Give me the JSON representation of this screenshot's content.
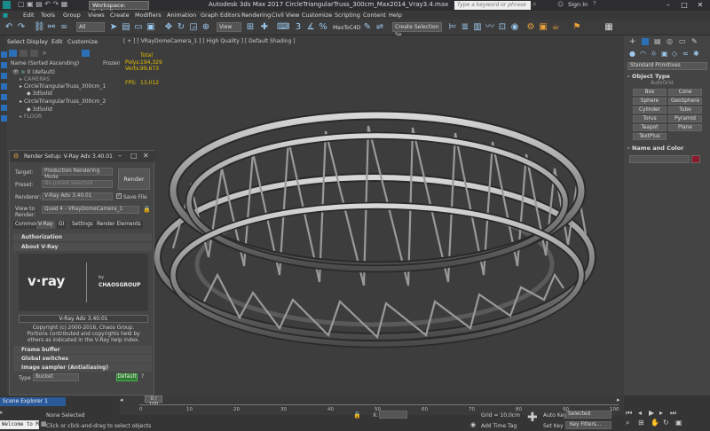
{
  "titlebar": {
    "workspace": "Workspace: Default",
    "title": "Autodesk 3ds Max 2017    CircleTriangularTruss_300cm_Max2014_Vray3.4.max",
    "search_placeholder": "Type a keyword or phrase",
    "sign_in": "Sign In"
  },
  "menu": [
    "Edit",
    "Tools",
    "Group",
    "Views",
    "Create",
    "Modifiers",
    "Animation",
    "Graph Editors",
    "Rendering",
    "Civil View",
    "Customize",
    "Scripting",
    "Content",
    "Help"
  ],
  "toolbar": {
    "filter": "All",
    "view": "View",
    "maxtoc4d": "MaxToC4D",
    "selection_set": "Create Selection Se"
  },
  "scene_explorer": {
    "menu": [
      "Select",
      "Display",
      "Edit",
      "Customize"
    ],
    "header": "Name (Sorted Ascending)",
    "frozen": "Frozen",
    "rows": [
      "0 (default)",
      "CAMERAS",
      "CircleTriangularTruss_300cm_1",
      "3dSolid",
      "CircleTriangularTruss_300cm_2",
      "3dSolid",
      "FLOOR"
    ],
    "footer": "Scene Explorer 1"
  },
  "viewport": {
    "label": "[ + ] [ VRayDomeCamera_1 ] [ High Quality ] [ Default Shading ]",
    "stats": {
      "total": "Total",
      "polys_label": "Polys:",
      "polys": "194,329",
      "verts_label": "Verts:",
      "verts": "99,673",
      "fps_label": "FPS:",
      "fps": "13,012"
    }
  },
  "command_panel": {
    "dropdown": "Standard Primitives",
    "object_type": "Object Type",
    "autogrid": "AutoGrid",
    "buttons": [
      "Box",
      "Cone",
      "Sphere",
      "GeoSphere",
      "Cylinder",
      "Tube",
      "Torus",
      "Pyramid",
      "Teapot",
      "Plane",
      "TextPlus"
    ],
    "name_and_color": "Name and Color",
    "color": "#8b1a2b"
  },
  "render_setup": {
    "title": "Render Setup: V-Ray Adv 3.40.01",
    "target_label": "Target:",
    "target": "Production Rendering Mode",
    "preset_label": "Preset:",
    "preset": "No preset selected",
    "renderer_label": "Renderer:",
    "renderer": "V-Ray Adv 3.40.01",
    "save_file": "Save File",
    "view_label": "View to Render:",
    "view": "Quad 4 - VRayDomeCamera_1",
    "render_btn": "Render",
    "tabs": [
      "Common",
      "V-Ray",
      "GI",
      "Settings",
      "Render Elements"
    ],
    "rollouts": [
      "Authorization",
      "About V-Ray"
    ],
    "logo_text": "v·ray",
    "by": "by",
    "chaos": "CHAOSGROUP",
    "version": "V-Ray Adv 3.40.01",
    "copyright": "Copyright (c) 2000-2016, Chaos Group.",
    "portions": "Portions contributed and copyrights held by others as indicated in the V-Ray help index.",
    "rollouts2": [
      "Frame buffer",
      "Global switches",
      "Image sampler (Antialiasing)"
    ],
    "type_label": "Type",
    "type": "Bucket",
    "default_btn": "Default"
  },
  "bottom": {
    "timeline": "0 / 100",
    "none_selected": "None Selected",
    "hint": "Click or click-and-drag to select objects",
    "welcome": "Welcome to M",
    "x_label": "X:",
    "grid": "Grid = 10,0cm",
    "add_time_tag": "Add Time Tag",
    "auto_key": "Auto Key",
    "selected": "Selected",
    "set_key": "Set Key",
    "key_filters": "Key Filters...",
    "ticks": [
      "0",
      "10",
      "20",
      "30",
      "40",
      "50",
      "60",
      "70",
      "80",
      "90",
      "100"
    ]
  }
}
